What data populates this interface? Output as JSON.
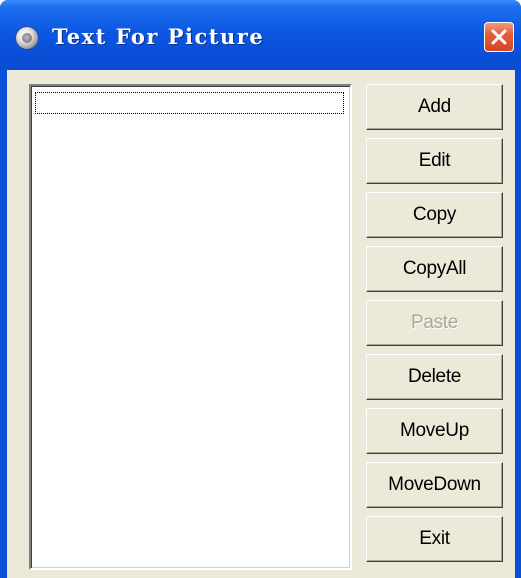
{
  "window": {
    "title": "Text For Picture",
    "close_icon": "close-x-icon",
    "app_icon": "disc-icon"
  },
  "listbox": {
    "items": []
  },
  "buttons": {
    "add": "Add",
    "edit": "Edit",
    "copy": "Copy",
    "copyall": "CopyAll",
    "paste": "Paste",
    "delete": "Delete",
    "moveup": "MoveUp",
    "movedown": "MoveDown",
    "exit": "Exit"
  },
  "states": {
    "paste_enabled": false
  },
  "colors": {
    "titlebar": "#0a4fd8",
    "close_button": "#e4603b",
    "client_background": "#ece9d8",
    "disabled_text": "#aca899"
  }
}
